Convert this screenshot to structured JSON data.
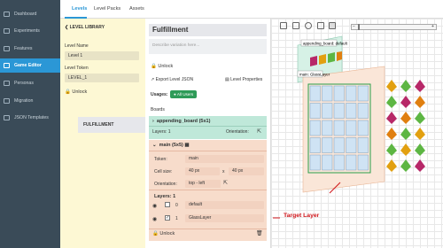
{
  "sidebar": {
    "items": [
      {
        "label": "Dashboard",
        "icon": "dashboard-icon"
      },
      {
        "label": "Experiments",
        "icon": "flask-icon"
      },
      {
        "label": "Features",
        "icon": "flag-icon"
      },
      {
        "label": "Game Editor",
        "icon": "gamepad-icon",
        "active": true
      },
      {
        "label": "Personas",
        "icon": "user-icon"
      },
      {
        "label": "Migration",
        "icon": "migration-icon"
      },
      {
        "label": "JSON Templates",
        "icon": "code-icon"
      }
    ]
  },
  "topnav": {
    "tabs": [
      "Levels",
      "Level Packs",
      "Assets"
    ]
  },
  "library": {
    "header": "LEVEL LIBRARY",
    "name_label": "Level Name",
    "name_value": "Level 1",
    "token_label": "Level Token",
    "token_value": "LEVEL_1",
    "unlock": "Unlock",
    "fulfillment": "FULFILLMENT"
  },
  "main": {
    "title": "Fulfillment",
    "description_placeholder": "Describe variation here...",
    "unlock": "Unlock",
    "export": "Export Level JSON",
    "properties": "Level Properties",
    "usages_label": "Usages:",
    "usages_badge": "All Users",
    "boards_label": "Boards",
    "board1": {
      "title": "appending_board (5x1)",
      "layers": "Layers: 1",
      "orientation": "Orientation:"
    },
    "board2": {
      "title": "main (5x5)",
      "token_label": "Token:",
      "token_value": "main",
      "cellsize_label": "Cell size:",
      "cell_w": "40 px",
      "x": "x",
      "cell_h": "40 px",
      "orientation_label": "Orientation:",
      "orientation_value": "top - left",
      "layers_label": "Layers: 1",
      "layer0_index": "0",
      "layer0_name": "default",
      "layer1_index": "1",
      "layer1_name": "GlassLayer"
    },
    "footer_unlock": "Unlock"
  },
  "canvas": {
    "appending_label": "appending_board: default",
    "main_label": "main: GlassLayer",
    "annotation": "Target Layer"
  },
  "colors": {
    "sidebar": "#3a4b58",
    "accent": "#2b97d6",
    "library_bg": "#fdf8d4",
    "board_green": "#bfe8d9",
    "board_orange": "#f7dccb",
    "annotation_red": "#d0161b"
  }
}
